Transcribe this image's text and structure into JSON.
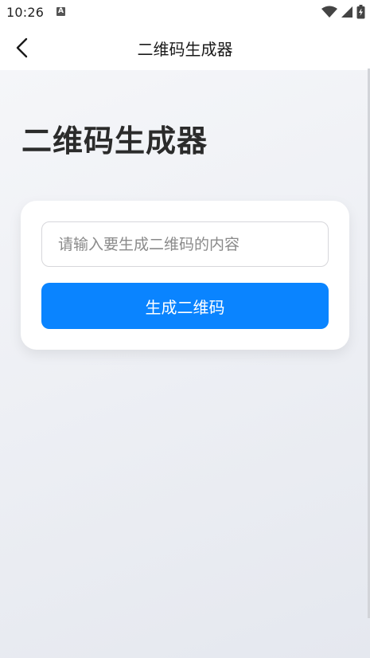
{
  "status_bar": {
    "time": "10:26",
    "notification_icon": "A",
    "icons": [
      "wifi-icon",
      "signal-icon",
      "battery-icon"
    ]
  },
  "app_bar": {
    "back_icon": "chevron-left-icon",
    "title": "二维码生成器"
  },
  "main": {
    "page_title": "二维码生成器",
    "input": {
      "value": "",
      "placeholder": "请输入要生成二维码的内容"
    },
    "generate_button_label": "生成二维码"
  },
  "colors": {
    "accent": "#0a84ff",
    "background_top": "#f5f6f9",
    "background_bottom": "#e5e8ef",
    "card": "#ffffff"
  }
}
